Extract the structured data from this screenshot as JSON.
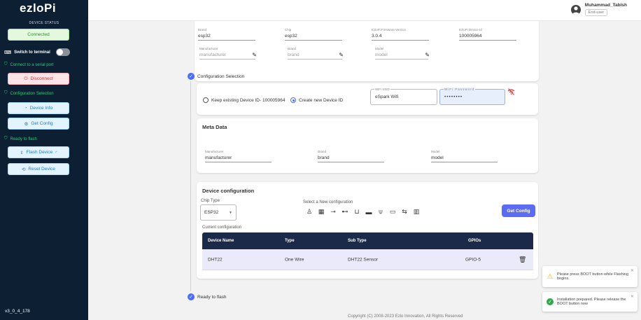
{
  "sidebar": {
    "logo": "ezloPi",
    "device_status_label": "DEVICE STATUS",
    "connected_label": "Connected",
    "switch_terminal_label": "Switch to terminal",
    "connect_serial_label": "Connect to a serial port",
    "disconnect_label": "Disconnect",
    "config_selection_label": "Configuration Selection",
    "device_info_label": "Device Info",
    "get_config_label": "Get Config",
    "ready_to_flash_label": "Ready to flash",
    "flash_device_label": "Flash Device",
    "reset_device_label": "Reset Device",
    "version": "v3_0_4_178"
  },
  "user": {
    "name": "Muhammad_Tabish",
    "role": "End-user"
  },
  "device_info": {
    "brand_label": "Brand",
    "brand_value": "esp32",
    "chip_label": "Chip",
    "chip_value": "esp32",
    "firmware_label": "EzloPi Firmware Version",
    "firmware_value": "3.0.4",
    "device_id_label": "EzloPi Device Id",
    "device_id_value": "100005964",
    "manufacturer_label": "Manufacturer",
    "manufacturer_value": "manufacturer",
    "brand2_label": "Brand",
    "brand2_value": "brand",
    "model_label": "Model",
    "model_value": "model"
  },
  "steps": {
    "config_selection": "Configuration Selection",
    "ready_to_flash": "Ready to flash"
  },
  "config": {
    "keep_existing_label": "Keep existing Device ID- 100005964",
    "create_new_label": "Create new Device ID",
    "wifi_ssid_label": "WiFi SSID",
    "wifi_ssid_value": "eSpark Wifi",
    "wifi_password_label": "WiFi Password",
    "wifi_password_value": "••••••••"
  },
  "meta": {
    "title": "Meta Data",
    "manufacturer_label": "Manufacturer",
    "manufacturer_value": "manufacturer",
    "brand_label": "Brand",
    "brand_value": "brand",
    "model_label": "Model",
    "model_value": "model"
  },
  "devcfg": {
    "title": "Device configuration",
    "chip_type_label": "Chip Type",
    "chip_type_value": "ESP32",
    "select_new_label": "Select a New configuration",
    "get_config_button": "Get Config",
    "current_config_label": "Current configuration",
    "columns": [
      "Device Name",
      "Type",
      "Sub Type",
      "GPIOs"
    ],
    "rows": [
      [
        "DHT22",
        "One Wire",
        "DHT22 Sensor",
        "GPIO-5"
      ]
    ]
  },
  "toasts": [
    "Please press BOOT button while Flashing begins.",
    "Installation prepared. Please release the BOOT button now"
  ],
  "footer": "Copyright (C) 2008-2023 Ezlo Innovation, All Rights Reserved",
  "colors": {
    "sidebar_bg": "#0c1f33",
    "accent": "#5b6cf2",
    "success": "#2eaa4a",
    "warning": "#f5b400",
    "table_header": "#1c2a4a"
  }
}
